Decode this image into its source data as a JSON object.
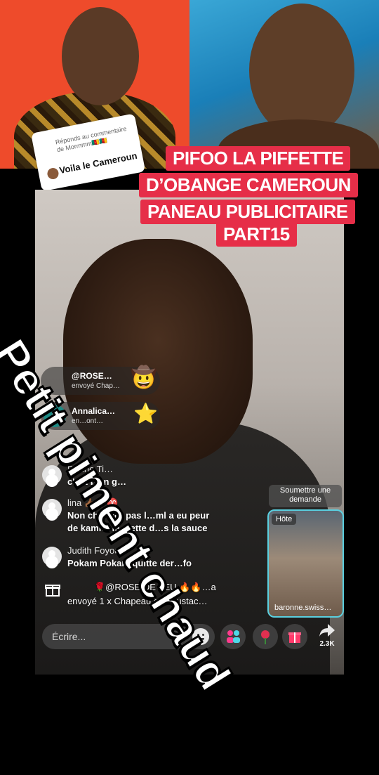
{
  "reply_sticker": {
    "prefix": "Réponds au commentaire de Mormmm",
    "flags": "🇨🇲🇨🇲",
    "text": "Voila le Cameroun"
  },
  "title_lines": [
    "PIFOO LA PIFFETTE",
    "D’OBANGE CAMEROUN",
    "PANEAU PUBLICITAIRE",
    "PART15"
  ],
  "overlay_caption": "Petit piment chaud",
  "gifts": [
    {
      "user": "@ROSE…",
      "action": "envoyé  Chap…",
      "emoji": "🤠"
    },
    {
      "user": "Annalica…",
      "action": "en…ont…",
      "emoji": "⭐",
      "avatar_letter": "L"
    }
  ],
  "comments": [
    {
      "name": "Dorine Ti…",
      "text": "c'est bien g…"
    },
    {
      "name": "lina 👍🏾👎🏾♈",
      "text": "Non changer pas l…ml a eu peur",
      "text2": "de kamini le mette d…s la sauce"
    },
    {
      "name": "Judith Foyou",
      "text": "Pokam Pokam quitte der…fo"
    }
  ],
  "gift_message": {
    "line1": "🌹@ROSE  DE FEU 🔥🔥…a",
    "line2": "envoyé 1 x Chapeau et moustac…"
  },
  "request_button": "Soumettre une demande",
  "host": {
    "tag": "Hôte",
    "name": "baronne.swiss…"
  },
  "input": {
    "placeholder": "Écrire..."
  },
  "share_count": "2.3K",
  "colors": {
    "title_bg": "#e62e48",
    "left_panel_bg": "#ee4b2b",
    "host_border": "#5ad0e0"
  }
}
